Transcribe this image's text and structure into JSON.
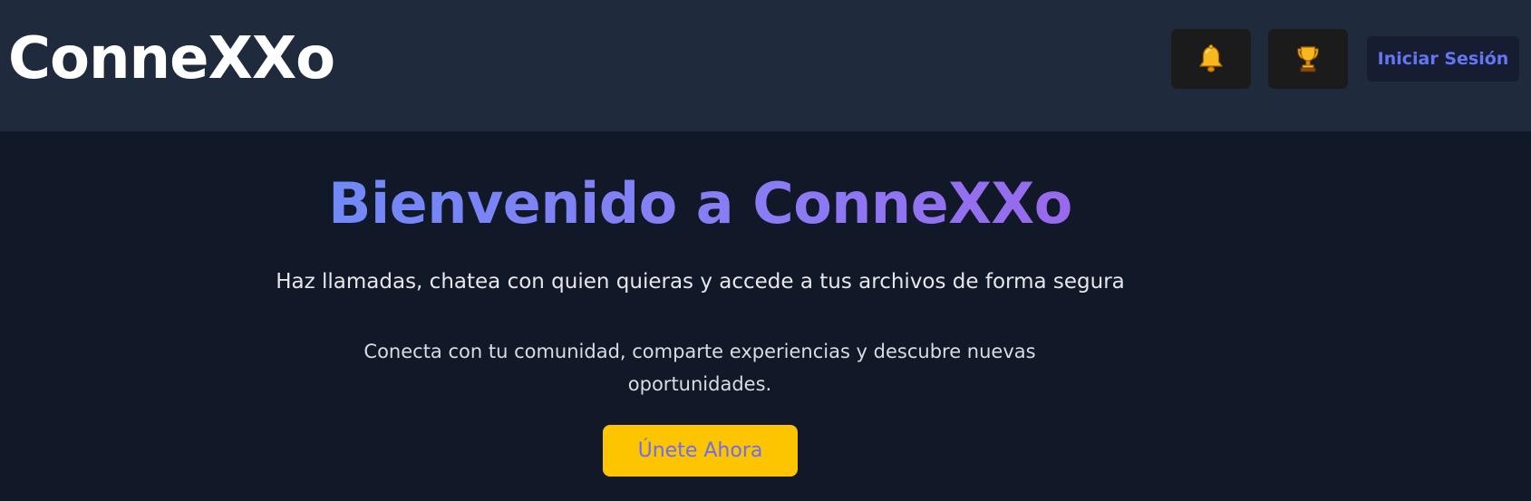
{
  "header": {
    "brand": "ConneXXo",
    "notifications_icon": "bell-icon",
    "achievements_icon": "trophy-icon",
    "login_label": "Iniciar Sesión"
  },
  "hero": {
    "title": "Bienvenido a ConneXXo",
    "subtitle": "Haz llamadas, chatea con quien quieras y accede a tus archivos de forma segura",
    "description": "Conecta con tu comunidad, comparte experiencias y descubre nuevas oportunidades.",
    "cta_label": "Únete Ahora"
  },
  "colors": {
    "header_bg": "#1f2a3c",
    "page_bg": "#111827",
    "cta_bg": "#fcc500",
    "accent": "#6675f2",
    "title_gradient_start": "#6390f6",
    "title_gradient_end": "#a35ae8"
  }
}
